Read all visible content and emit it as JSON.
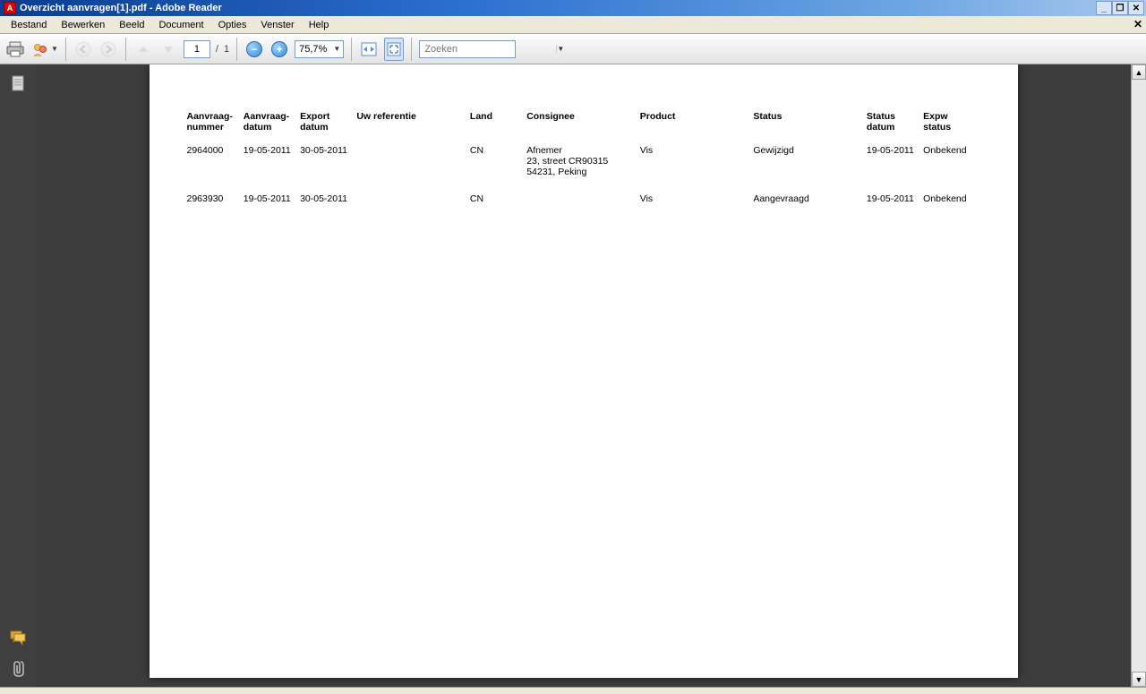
{
  "title": "Overzicht aanvragen[1].pdf - Adobe Reader",
  "menu": [
    "Bestand",
    "Bewerken",
    "Beeld",
    "Document",
    "Opties",
    "Venster",
    "Help"
  ],
  "toolbar": {
    "page_current": "1",
    "page_sep": "/",
    "page_total": "1",
    "zoom": "75,7%",
    "search_placeholder": "Zoeken"
  },
  "sidebar_icons": {
    "pages": "pages-panel-icon",
    "comments": "comments-panel-icon",
    "attachments": "attachments-panel-icon"
  },
  "headers": {
    "aanvraagnummer": "Aanvraag-\nnummer",
    "aanvraagdatum": "Aanvraag-\ndatum",
    "exportdatum": "Export\ndatum",
    "uwreferentie": "Uw referentie",
    "land": "Land",
    "consignee": "Consignee",
    "product": "Product",
    "status": "Status",
    "statusdatum": "Status\ndatum",
    "expwstatus": "Expw\nstatus"
  },
  "rows": [
    {
      "aanvraagnummer": "2964000",
      "aanvraagdatum": "19-05-2011",
      "exportdatum": "30-05-2011",
      "uwreferentie": "",
      "land": "CN",
      "consignee": "Afnemer\n23, street CR90315\n54231, Peking",
      "product": "Vis",
      "status": "Gewijzigd",
      "statusdatum": "19-05-2011",
      "expwstatus": "Onbekend"
    },
    {
      "aanvraagnummer": "2963930",
      "aanvraagdatum": "19-05-2011",
      "exportdatum": "30-05-2011",
      "uwreferentie": "",
      "land": "CN",
      "consignee": "",
      "product": "Vis",
      "status": "Aangevraagd",
      "statusdatum": "19-05-2011",
      "expwstatus": "Onbekend"
    }
  ]
}
